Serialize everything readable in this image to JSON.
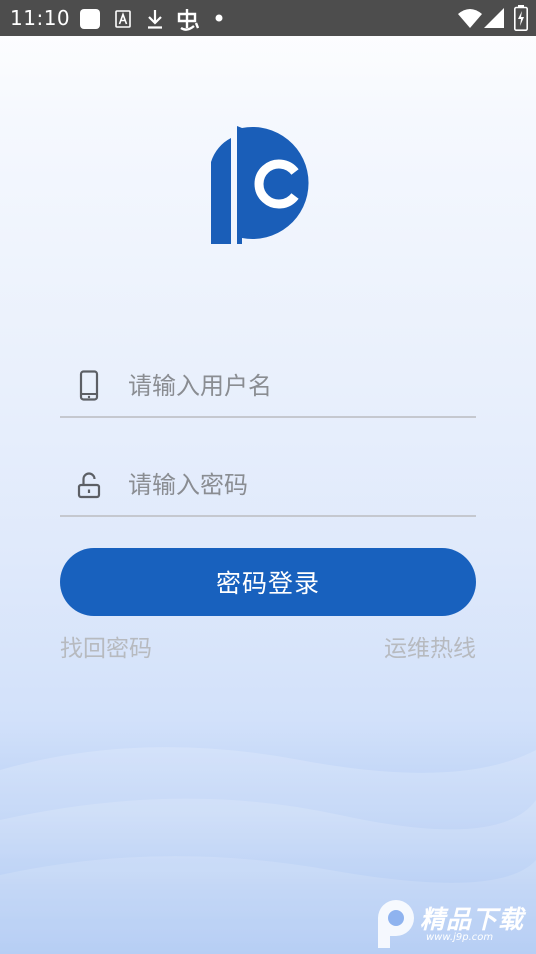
{
  "status_bar": {
    "time": "11:10",
    "icons": [
      "app-square-icon",
      "text-a-icon",
      "download-icon",
      "bug-icon",
      "dot-icon",
      "wifi-icon",
      "signal-icon",
      "battery-charging-icon"
    ]
  },
  "logo": {
    "name": "pc-logo",
    "color": "#1a5eb8"
  },
  "form": {
    "username_placeholder": "请输入用户名",
    "username_value": "",
    "password_placeholder": "请输入密码",
    "password_value": ""
  },
  "login_button": {
    "label": "密码登录",
    "color": "#1861be"
  },
  "links": {
    "forgot_password": "找回密码",
    "support_hotline": "运维热线"
  },
  "watermark": {
    "title": "精品下载",
    "url": "www.j9p.com"
  }
}
